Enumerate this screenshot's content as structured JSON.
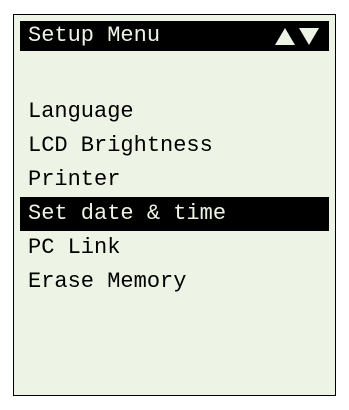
{
  "header": {
    "title": "Setup Menu",
    "scroll_icons": [
      "up-arrow-icon",
      "down-arrow-icon"
    ]
  },
  "menu": {
    "items": [
      {
        "label": "Language",
        "selected": false
      },
      {
        "label": "LCD Brightness",
        "selected": false
      },
      {
        "label": "Printer",
        "selected": false
      },
      {
        "label": "Set date & time",
        "selected": true
      },
      {
        "label": "PC Link",
        "selected": false
      },
      {
        "label": "Erase Memory",
        "selected": false
      }
    ]
  },
  "colors": {
    "screen_background": "#edf4e5",
    "foreground": "#000000"
  }
}
